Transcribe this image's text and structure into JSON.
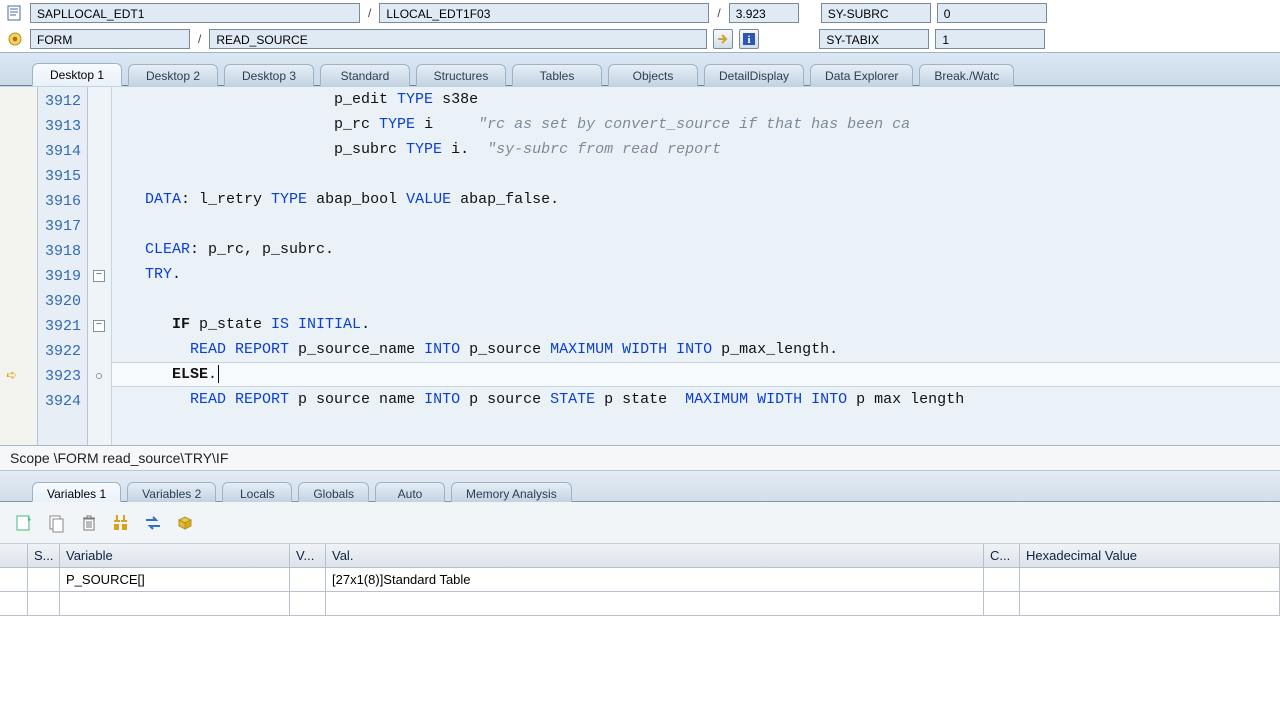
{
  "header": {
    "program": "SAPLLOCAL_EDT1",
    "include": "LLOCAL_EDT1F03",
    "line": "3.923",
    "subrc_label": "SY-SUBRC",
    "subrc_value": "0",
    "type": "FORM",
    "routine": "READ_SOURCE",
    "tabix_label": "SY-TABIX",
    "tabix_value": "1"
  },
  "tabs": {
    "list": [
      "Desktop 1",
      "Desktop 2",
      "Desktop 3",
      "Standard",
      "Structures",
      "Tables",
      "Objects",
      "DetailDisplay",
      "Data Explorer",
      "Break./Watc"
    ],
    "active": 0
  },
  "source": {
    "first_line": 3912,
    "current_line_index": 11,
    "lines": [
      {
        "segs": [
          {
            "t": "                        p_edit ",
            "c": "txt"
          },
          {
            "t": "TYPE",
            "c": "kw-blue"
          },
          {
            "t": " s38e",
            "c": "txt"
          }
        ]
      },
      {
        "segs": [
          {
            "t": "                        p_rc ",
            "c": "txt"
          },
          {
            "t": "TYPE",
            "c": "kw-blue"
          },
          {
            "t": " i     ",
            "c": "txt"
          },
          {
            "t": "\"rc as set by convert_source if that has been ca",
            "c": "comment"
          }
        ]
      },
      {
        "segs": [
          {
            "t": "                        p_subrc ",
            "c": "txt"
          },
          {
            "t": "TYPE",
            "c": "kw-blue"
          },
          {
            "t": " i.  ",
            "c": "txt"
          },
          {
            "t": "\"sy-subrc from read report",
            "c": "comment"
          }
        ]
      },
      {
        "segs": [
          {
            "t": "",
            "c": "txt"
          }
        ]
      },
      {
        "segs": [
          {
            "t": "   ",
            "c": "txt"
          },
          {
            "t": "DATA",
            "c": "kw-blue"
          },
          {
            "t": ": l_retry ",
            "c": "txt"
          },
          {
            "t": "TYPE",
            "c": "kw-blue"
          },
          {
            "t": " abap_bool ",
            "c": "txt"
          },
          {
            "t": "VALUE",
            "c": "kw-blue"
          },
          {
            "t": " abap_false.",
            "c": "txt"
          }
        ]
      },
      {
        "segs": [
          {
            "t": "",
            "c": "txt"
          }
        ]
      },
      {
        "segs": [
          {
            "t": "   ",
            "c": "txt"
          },
          {
            "t": "CLEAR",
            "c": "kw-blue"
          },
          {
            "t": ": p_rc, p_subrc.",
            "c": "txt"
          }
        ]
      },
      {
        "segs": [
          {
            "t": "   ",
            "c": "txt"
          },
          {
            "t": "TRY",
            "c": "kw-blue"
          },
          {
            "t": ".",
            "c": "txt"
          }
        ],
        "fold": "minus"
      },
      {
        "segs": [
          {
            "t": "",
            "c": "txt"
          }
        ]
      },
      {
        "segs": [
          {
            "t": "      ",
            "c": "txt"
          },
          {
            "t": "IF",
            "c": "kw-black"
          },
          {
            "t": " p_state ",
            "c": "txt"
          },
          {
            "t": "IS INITIAL",
            "c": "kw-blue"
          },
          {
            "t": ".",
            "c": "txt"
          }
        ],
        "fold": "minus"
      },
      {
        "segs": [
          {
            "t": "        ",
            "c": "txt"
          },
          {
            "t": "READ REPORT",
            "c": "kw-blue"
          },
          {
            "t": " p_source_name ",
            "c": "txt"
          },
          {
            "t": "INTO",
            "c": "kw-blue"
          },
          {
            "t": " p_source ",
            "c": "txt"
          },
          {
            "t": "MAXIMUM WIDTH INTO",
            "c": "kw-blue"
          },
          {
            "t": " p_max_length.",
            "c": "txt"
          }
        ]
      },
      {
        "segs": [
          {
            "t": "      ",
            "c": "txt"
          },
          {
            "t": "ELSE",
            "c": "kw-black"
          },
          {
            "t": ".",
            "c": "txt"
          }
        ],
        "fold": "dot",
        "cursor": true
      },
      {
        "segs": [
          {
            "t": "        ",
            "c": "txt"
          },
          {
            "t": "READ REPORT",
            "c": "kw-blue"
          },
          {
            "t": " p source name ",
            "c": "txt"
          },
          {
            "t": "INTO",
            "c": "kw-blue"
          },
          {
            "t": " p source ",
            "c": "txt"
          },
          {
            "t": "STATE",
            "c": "kw-blue"
          },
          {
            "t": " p state  ",
            "c": "txt"
          },
          {
            "t": "MAXIMUM WIDTH INTO",
            "c": "kw-blue"
          },
          {
            "t": " p max length",
            "c": "txt"
          }
        ]
      }
    ]
  },
  "scope": "Scope \\FORM read_source\\TRY\\IF",
  "var_tabs": {
    "list": [
      "Variables 1",
      "Variables 2",
      "Locals",
      "Globals",
      "Auto",
      "Memory Analysis"
    ],
    "active": 0
  },
  "var_table": {
    "headers": {
      "s": "S...",
      "variable": "Variable",
      "v": "V...",
      "val": "Val.",
      "c": "C...",
      "hex": "Hexadecimal Value"
    },
    "rows": [
      {
        "variable": "P_SOURCE[]",
        "val": "[27x1(8)]Standard Table"
      }
    ]
  }
}
